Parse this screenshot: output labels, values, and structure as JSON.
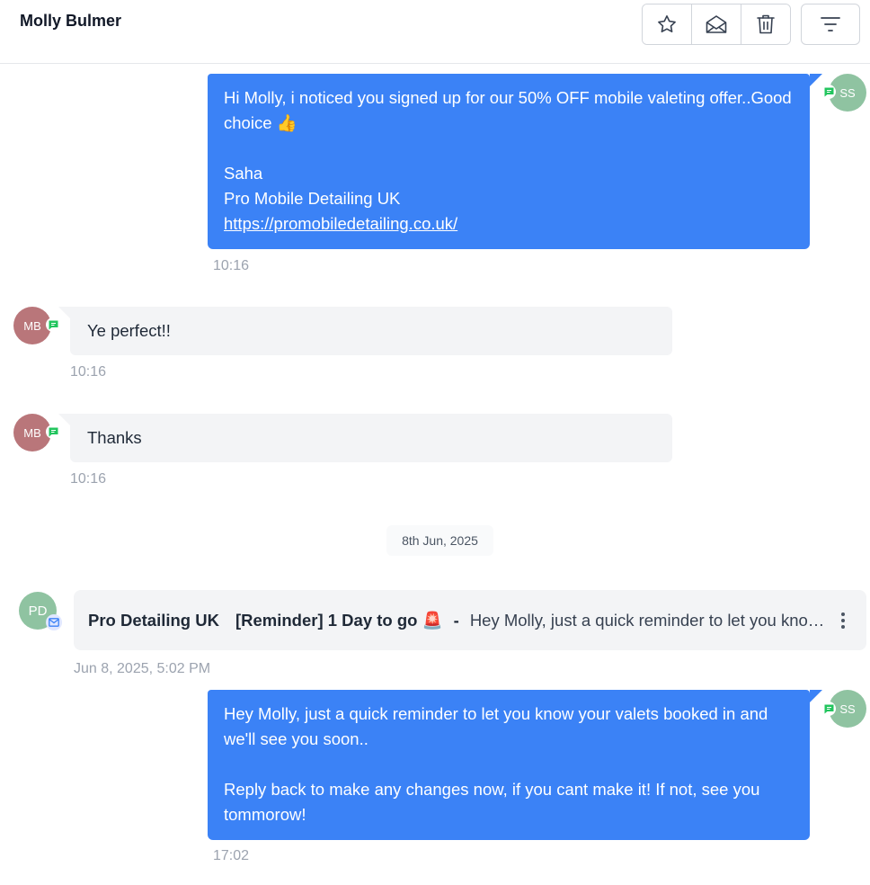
{
  "header": {
    "contact_name": "Molly Bulmer",
    "actions": [
      {
        "icon": "star-icon"
      },
      {
        "icon": "envelope-open-icon"
      },
      {
        "icon": "trash-icon"
      },
      {
        "icon": "filter-icon"
      }
    ]
  },
  "messages": {
    "m1": {
      "avatar": "SS",
      "body": "Hi Molly, i noticed you signed up for our 50% OFF mobile valeting offer..Good choice 👍\n\nSaha\nPro Mobile Detailing UK",
      "link": "https://promobiledetailing.co.uk/",
      "time": "10:16"
    },
    "m2": {
      "avatar": "MB",
      "body": "Ye perfect!!",
      "time": "10:16"
    },
    "m3": {
      "avatar": "MB",
      "body": "Thanks",
      "time": "10:16"
    },
    "date_divider": "8th Jun, 2025",
    "email": {
      "avatar": "PD",
      "from": "Pro Detailing UK",
      "subject": "[Reminder] 1 Day to go 🚨",
      "separator": "-",
      "preview": "Hey Molly, just a quick reminder to let you know your valets booked in and we'll see you soon..",
      "time": "Jun 8, 2025, 5:02 PM"
    },
    "m5": {
      "avatar": "SS",
      "body": "Hey Molly, just a quick reminder to let you know your valets booked in and we'll see you soon..\n\nReply back to make any changes now, if you cant make it! If not, see you tommorow!",
      "time": "17:02"
    }
  },
  "colors": {
    "outgoing_bubble": "#3b82f6",
    "incoming_bubble": "#f3f4f6",
    "avatar_ss": "#8fc3a1",
    "avatar_mb": "#b9767a",
    "sms_badge": "#22c55e",
    "email_badge": "#3b82f6"
  }
}
